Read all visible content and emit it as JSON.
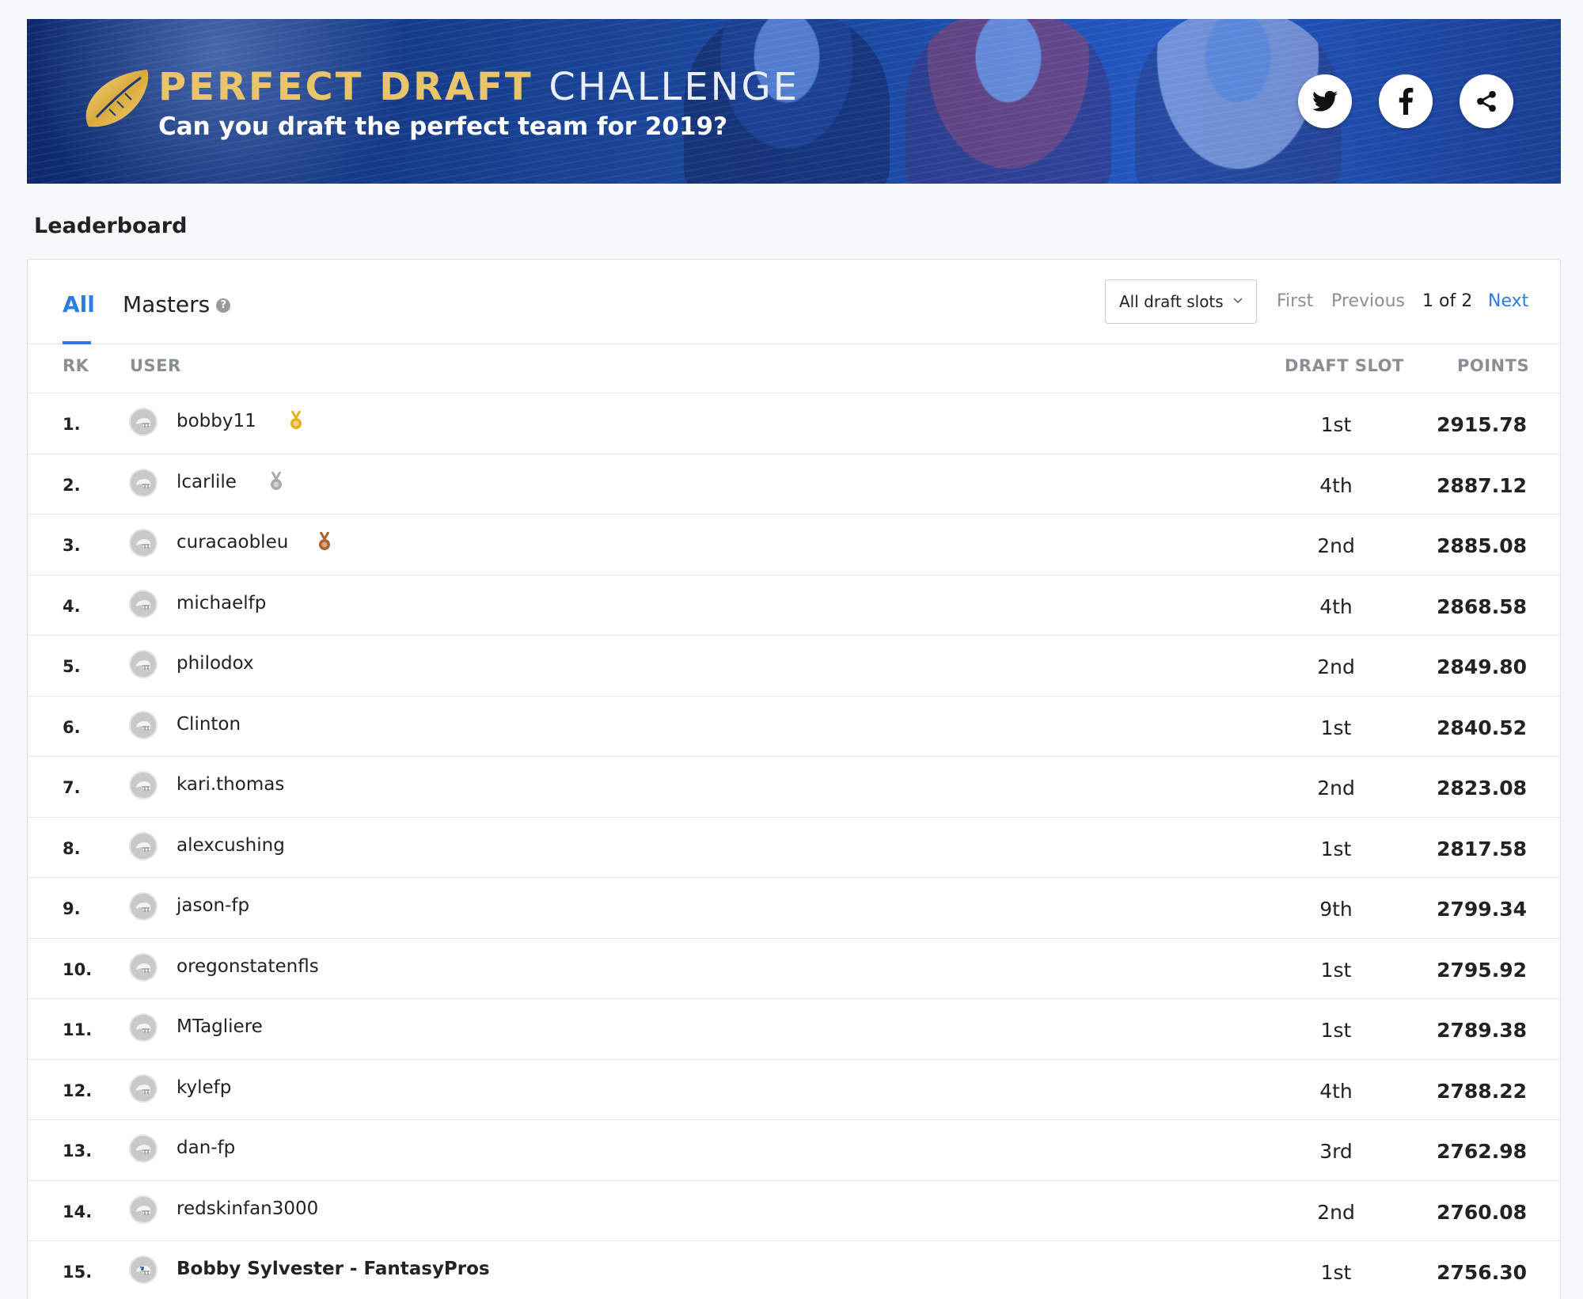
{
  "banner": {
    "title_gold": "PERFECT DRAFT",
    "title_white": "CHALLENGE",
    "subtitle": "Can you draft the perfect team for 2019?",
    "social": [
      "twitter-icon",
      "facebook-icon",
      "share-icon"
    ],
    "colors": {
      "gold": "#e9c46a",
      "banner_blue": "#1c4aa3"
    }
  },
  "leaderboard": {
    "heading": "Leaderboard",
    "tabs": [
      {
        "label": "All",
        "active": true
      },
      {
        "label": "Masters",
        "active": false
      }
    ],
    "filter": {
      "selected": "All draft slots"
    },
    "pager": {
      "first": "First",
      "previous": "Previous",
      "count": "1 of 2",
      "next": "Next"
    },
    "columns": {
      "rank": "RK",
      "user": "USER",
      "draft_slot": "DRAFT SLOT",
      "points": "POINTS"
    },
    "rows": [
      {
        "rank": "1.",
        "user": "bobby11",
        "medal": "gold",
        "slot": "1st",
        "points": "2915.78"
      },
      {
        "rank": "2.",
        "user": "lcarlile",
        "medal": "silver",
        "slot": "4th",
        "points": "2887.12"
      },
      {
        "rank": "3.",
        "user": "curacaobleu",
        "medal": "bronze",
        "slot": "2nd",
        "points": "2885.08"
      },
      {
        "rank": "4.",
        "user": "michaelfp",
        "medal": "",
        "slot": "4th",
        "points": "2868.58"
      },
      {
        "rank": "5.",
        "user": "philodox",
        "medal": "",
        "slot": "2nd",
        "points": "2849.80"
      },
      {
        "rank": "6.",
        "user": "Clinton",
        "medal": "",
        "slot": "1st",
        "points": "2840.52"
      },
      {
        "rank": "7.",
        "user": "kari.thomas",
        "medal": "",
        "slot": "2nd",
        "points": "2823.08"
      },
      {
        "rank": "8.",
        "user": "alexcushing",
        "medal": "",
        "slot": "1st",
        "points": "2817.58"
      },
      {
        "rank": "9.",
        "user": "jason-fp",
        "medal": "",
        "slot": "9th",
        "points": "2799.34"
      },
      {
        "rank": "10.",
        "user": "oregonstatenfls",
        "medal": "",
        "slot": "1st",
        "points": "2795.92"
      },
      {
        "rank": "11.",
        "user": "MTagliere",
        "medal": "",
        "slot": "1st",
        "points": "2789.38"
      },
      {
        "rank": "12.",
        "user": "kylefp",
        "medal": "",
        "slot": "4th",
        "points": "2788.22"
      },
      {
        "rank": "13.",
        "user": "dan-fp",
        "medal": "",
        "slot": "3rd",
        "points": "2762.98"
      },
      {
        "rank": "14.",
        "user": "redskinfan3000",
        "medal": "",
        "slot": "2nd",
        "points": "2760.08"
      },
      {
        "rank": "15.",
        "user": "Bobby Sylvester - FantasyPros",
        "medal": "",
        "slot": "1st",
        "points": "2756.30",
        "highlight": true
      }
    ],
    "colors": {
      "accent": "#2d7be5",
      "muted": "#8a8f96",
      "gold": "#e8b21c",
      "silver": "#a9a9b3",
      "bronze": "#b0622a"
    }
  }
}
